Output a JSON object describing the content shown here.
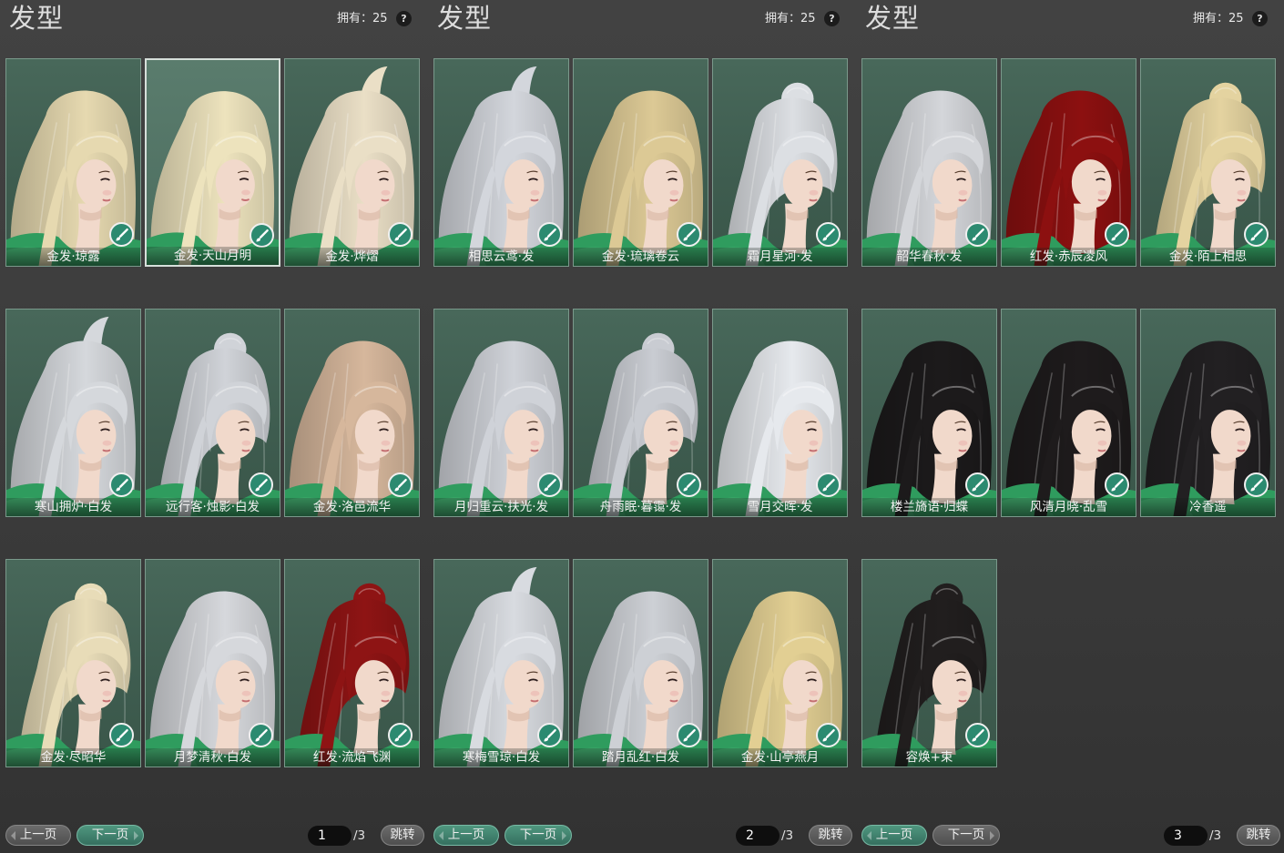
{
  "colors": {
    "skin": "#f1d9cb",
    "garment": "#2f9c5e",
    "card_bg": "#3e5c4f",
    "accent": "#3f8673",
    "button_gray": "#5c5c5c"
  },
  "icons": {
    "card_badge": "brush-icon",
    "help": "question-icon"
  },
  "panels": [
    {
      "title": "发型",
      "owned": "拥有：25",
      "help": "?",
      "cards": [
        {
          "label": "金发·琼露",
          "hair_color": "#e6d9b0",
          "selected": false
        },
        {
          "label": "金发·天山月明",
          "hair_color": "#ede3bd",
          "selected": true
        },
        {
          "label": "金发·烨熠",
          "hair_color": "#eadfc6",
          "selected": false
        },
        {
          "label": "寒山拥炉·白发",
          "hair_color": "#d5d8dc",
          "selected": false
        },
        {
          "label": "远行客·烛影·白发",
          "hair_color": "#d0d3d8",
          "selected": false
        },
        {
          "label": "金发·洛邑流华",
          "hair_color": "#d6b79c",
          "selected": false
        },
        {
          "label": "金发·尽昭华",
          "hair_color": "#e8dcb8",
          "selected": false
        },
        {
          "label": "月梦清秋·白发",
          "hair_color": "#d6d8dc",
          "selected": false
        },
        {
          "label": "红发·流焰飞渊",
          "hair_color": "#8e1414",
          "selected": false
        }
      ],
      "pager": {
        "prev": "上一页",
        "next": "下一页",
        "prev_active": false,
        "next_active": true,
        "page": "1",
        "total": "/3",
        "jump": "跳转"
      }
    },
    {
      "title": "发型",
      "owned": "拥有：25",
      "help": "?",
      "cards": [
        {
          "label": "相思云鸢·发",
          "hair_color": "#d3d6dc",
          "selected": false
        },
        {
          "label": "金发·琉璃卷云",
          "hair_color": "#dcc995",
          "selected": false
        },
        {
          "label": "霜月星河·发",
          "hair_color": "#dcdfe3",
          "selected": false
        },
        {
          "label": "月归重云·扶光·发",
          "hair_color": "#cfd2d8",
          "selected": false
        },
        {
          "label": "舟雨眠·暮霭·发",
          "hair_color": "#c9ccd2",
          "selected": false
        },
        {
          "label": "雪月交晖·发",
          "hair_color": "#e6e9ed",
          "selected": false
        },
        {
          "label": "寒梅雪琼·白发",
          "hair_color": "#d8dbe0",
          "selected": false
        },
        {
          "label": "踏月乱红·白发",
          "hair_color": "#cdd0d5",
          "selected": false
        },
        {
          "label": "金发·山亭燕月",
          "hair_color": "#e2cf93",
          "selected": false
        }
      ],
      "pager": {
        "prev": "上一页",
        "next": "下一页",
        "prev_active": true,
        "next_active": true,
        "page": "2",
        "total": "/3",
        "jump": "跳转"
      }
    },
    {
      "title": "发型",
      "owned": "拥有：25",
      "help": "?",
      "cards": [
        {
          "label": "韶华春秋·发",
          "hair_color": "#d4d6da",
          "selected": false
        },
        {
          "label": "红发·赤辰凌风",
          "hair_color": "#8c1010",
          "selected": false
        },
        {
          "label": "金发·陌上相思",
          "hair_color": "#e4d3a0",
          "selected": false
        },
        {
          "label": "楼兰旖语·归蝶",
          "hair_color": "#1c1a1b",
          "selected": false
        },
        {
          "label": "风清月晓·乱雪",
          "hair_color": "#1e1b1c",
          "selected": false
        },
        {
          "label": "冷香遥",
          "hair_color": "#222022",
          "selected": false
        },
        {
          "label": "容焕+束",
          "hair_color": "#211e1e",
          "selected": false
        }
      ],
      "pager": {
        "prev": "上一页",
        "next": "下一页",
        "prev_active": true,
        "next_active": false,
        "page": "3",
        "total": "/3",
        "jump": "跳转"
      }
    }
  ]
}
